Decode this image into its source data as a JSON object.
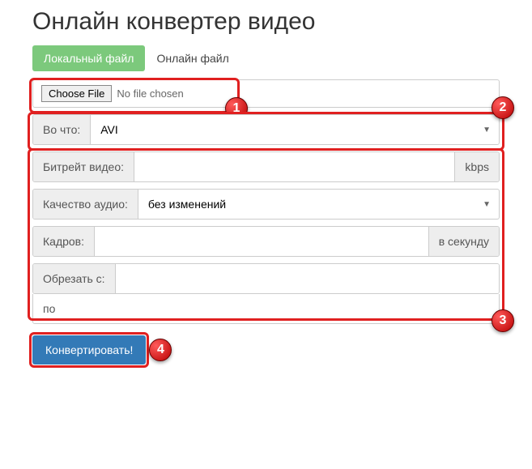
{
  "title": "Онлайн конвертер видео",
  "tabs": {
    "local": "Локальный файл",
    "online": "Онлайн файл"
  },
  "file": {
    "choose": "Choose File",
    "status": "No file chosen"
  },
  "format": {
    "label": "Во что:",
    "value": "AVI"
  },
  "bitrate": {
    "label": "Битрейт видео:",
    "suffix": "kbps"
  },
  "audio": {
    "label": "Качество аудио:",
    "value": "без изменений"
  },
  "fps": {
    "label": "Кадров:",
    "suffix": "в секунду"
  },
  "trim": {
    "from_label": "Обрезать с:",
    "to_label": "по"
  },
  "convert": "Конвертировать!",
  "markers": {
    "m1": "1",
    "m2": "2",
    "m3": "3",
    "m4": "4"
  }
}
